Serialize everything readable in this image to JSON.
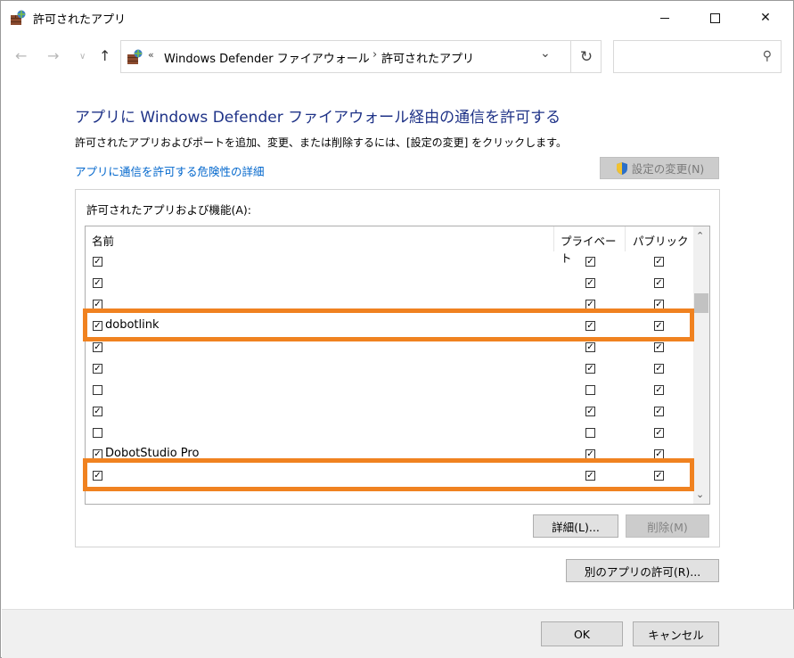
{
  "window": {
    "title": "許可されたアプリ",
    "minimize": "最小化",
    "maximize": "最大化",
    "close": "✕"
  },
  "addressbar": {
    "chevrons": "«",
    "segments": [
      "Windows Defender ファイアウォール",
      "許可されたアプリ"
    ],
    "separator": "›",
    "search_placeholder": ""
  },
  "main": {
    "heading": "アプリに Windows Defender ファイアウォール経由の通信を許可する",
    "description": "許可されたアプリおよびポートを追加、変更、または削除するには、[設定の変更] をクリックします。",
    "risk_link": "アプリに通信を許可する危険性の詳細",
    "change_settings_label": "設定の変更(N)",
    "group_label": "許可されたアプリおよび機能(A):"
  },
  "table": {
    "columns": [
      "名前",
      "プライベート",
      "パブリック"
    ],
    "rows": [
      {
        "name": "",
        "enabled": true,
        "private": true,
        "public": true
      },
      {
        "name": "",
        "enabled": true,
        "private": true,
        "public": true
      },
      {
        "name": "",
        "enabled": true,
        "private": true,
        "public": true
      },
      {
        "name": "dobotlink",
        "enabled": true,
        "private": true,
        "public": true
      },
      {
        "name": "",
        "enabled": true,
        "private": true,
        "public": true
      },
      {
        "name": "",
        "enabled": true,
        "private": true,
        "public": true
      },
      {
        "name": "",
        "enabled": false,
        "private": false,
        "public": true
      },
      {
        "name": "",
        "enabled": true,
        "private": true,
        "public": true
      },
      {
        "name": "",
        "enabled": false,
        "private": false,
        "public": true
      },
      {
        "name": "DobotStudio Pro",
        "enabled": true,
        "private": true,
        "public": true
      },
      {
        "name": "",
        "enabled": true,
        "private": true,
        "public": true
      }
    ]
  },
  "buttons": {
    "details": "詳細(L)...",
    "delete": "削除(M)",
    "allow_other": "別のアプリの許可(R)...",
    "ok": "OK",
    "cancel": "キャンセル"
  },
  "colors": {
    "heading": "#1e3287",
    "link": "#0066cc",
    "highlight": "#f08220"
  }
}
